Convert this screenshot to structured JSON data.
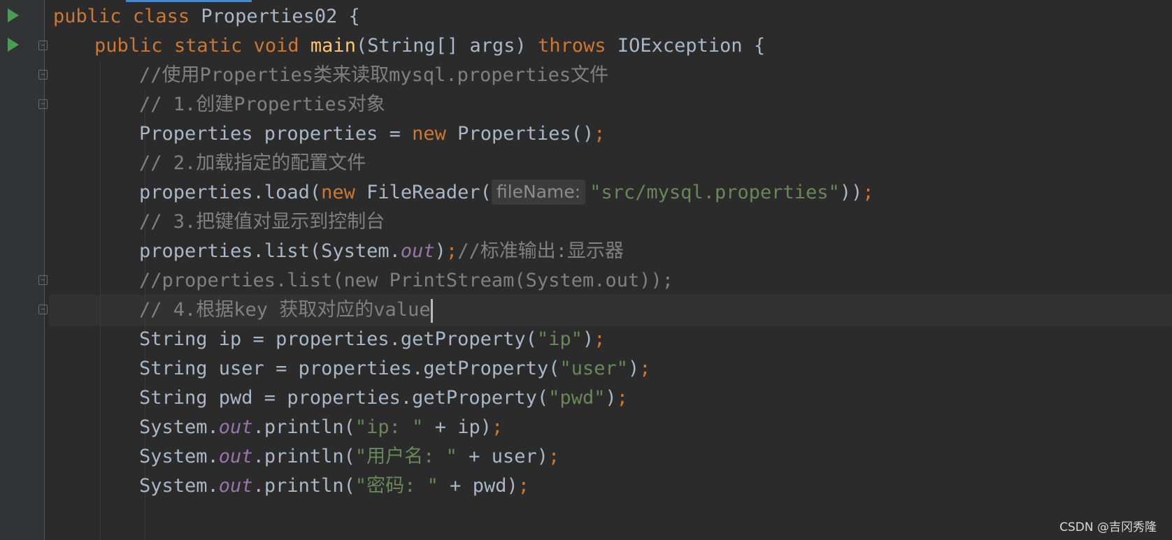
{
  "watermark": "CSDN @吉冈秀隆",
  "hint": {
    "param_name": "fileName:"
  },
  "lines": [
    [
      "public",
      "class",
      "Properties02 {"
    ],
    [
      "public",
      "static",
      "void",
      "main",
      "(String[] args)",
      "throws",
      "IOException {"
    ],
    [
      "//使用Properties类来读取mysql.properties文件"
    ],
    [
      "// 1.创建Properties对象"
    ],
    [
      "Properties properties = ",
      "new",
      " Properties()",
      ";"
    ],
    [
      "// 2.加载指定的配置文件"
    ],
    [
      "properties.load(",
      "new",
      " FileReader(",
      "\"src/mysql.properties\"",
      "))",
      ";"
    ],
    [
      "// 3.把键值对显示到控制台"
    ],
    [
      "properties.list(System.",
      "out",
      ")",
      ";",
      "//标准输出:显示器"
    ],
    [
      "//properties.list(new PrintStream(System.out));"
    ],
    [
      "// 4.根据key 获取对应的value"
    ],
    [
      "String ip = properties.getProperty(",
      "\"ip\"",
      ")",
      ";"
    ],
    [
      "String user = properties.getProperty(",
      "\"user\"",
      ")",
      ";"
    ],
    [
      "String pwd = properties.getProperty(",
      "\"pwd\"",
      ")",
      ";"
    ],
    [
      "System.",
      "out",
      ".println(",
      "\"ip: \"",
      " + ip)",
      ";"
    ],
    [
      "System.",
      "out",
      ".println(",
      "\"用户名: \"",
      " + user)",
      ";"
    ],
    [
      "System.",
      "out",
      ".println(",
      "\"密码: \"",
      " + pwd)",
      ";"
    ]
  ]
}
